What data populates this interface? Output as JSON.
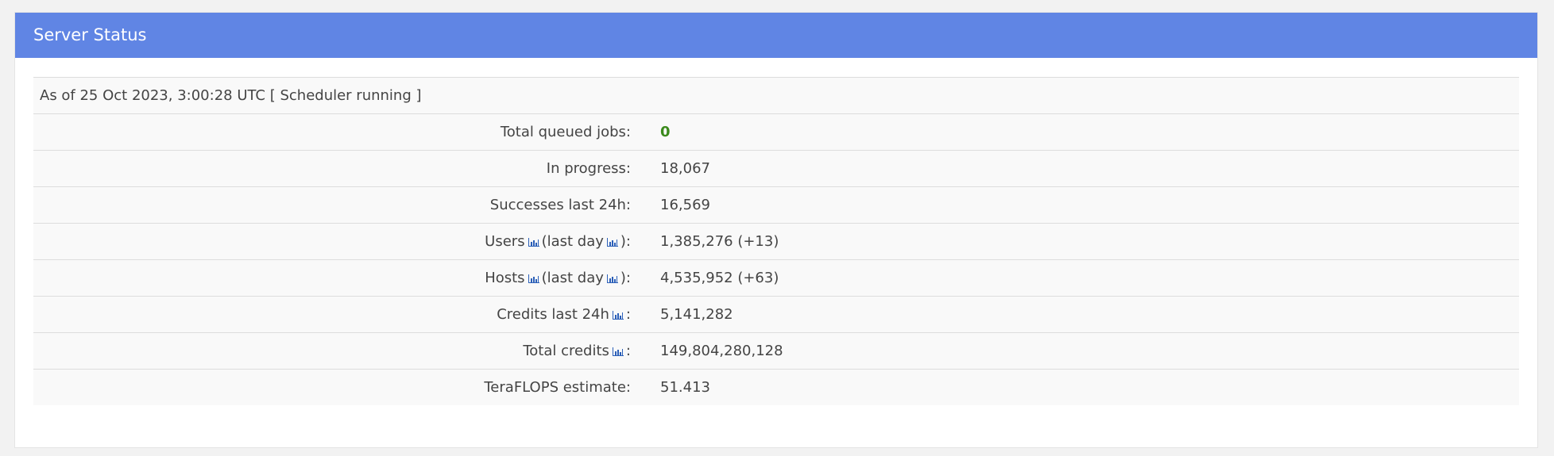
{
  "panel": {
    "title": "Server Status"
  },
  "status": {
    "timestamp": "As of 25 Oct 2023, 3:00:28 UTC [ Scheduler running ]",
    "total_queued_label": "Total queued jobs:",
    "total_queued_value": "0",
    "in_progress_label": "In progress:",
    "in_progress_value": "18,067",
    "successes_label": "Successes last 24h:",
    "successes_value": "16,569",
    "users_label_prefix": "Users",
    "users_label_mid": "(last day",
    "users_label_suffix": "):",
    "users_value": "1,385,276 (+13)",
    "hosts_label_prefix": "Hosts",
    "hosts_label_mid": "(last day",
    "hosts_label_suffix": "):",
    "hosts_value": "4,535,952 (+63)",
    "credits24_label_prefix": "Credits last 24h",
    "credits24_label_suffix": ":",
    "credits24_value": "5,141,282",
    "total_credits_label_prefix": "Total credits",
    "total_credits_label_suffix": ":",
    "total_credits_value": "149,804,280,128",
    "teraflops_label": "TeraFLOPS estimate:",
    "teraflops_value": "51.413"
  },
  "icons": {
    "graph": "bar-chart-icon"
  },
  "colors": {
    "header_bg": "#6085e4",
    "zero_value": "#3b8a1c",
    "icon": "#2b5fb8"
  }
}
